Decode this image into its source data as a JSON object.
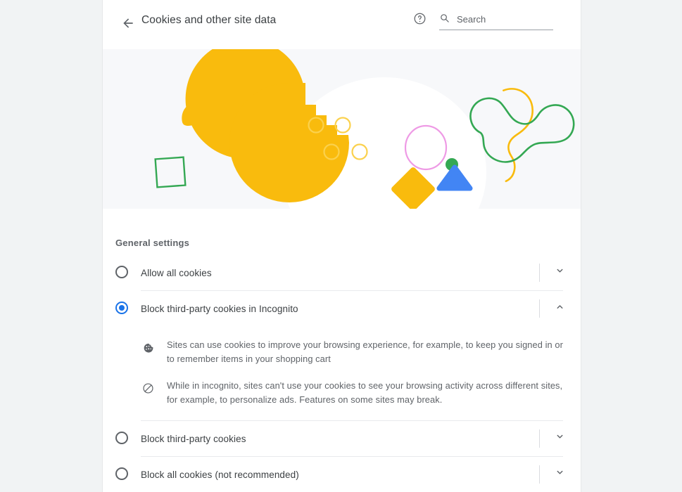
{
  "header": {
    "back_icon": "arrow-left-icon",
    "title": "Cookies and other site data",
    "help_icon": "help-circle-icon",
    "search_icon": "search-icon",
    "search_placeholder": "Search",
    "search_value": ""
  },
  "hero": {
    "illustration_name": "cookie-illustration",
    "colors": {
      "cookie_yellow": "#f9bb0d",
      "chip_outline": "#fbd14d",
      "blob_white": "#ffffff",
      "hero_background": "#f7f8fa",
      "blue_dot": "#a8c7fa",
      "gray_pill": "#e8eaed",
      "green_outline": "#34a853",
      "pink_circle": "#ee9ae5",
      "green_dot": "#34a853",
      "blue_triangle": "#4285f4"
    }
  },
  "settings": {
    "section_title": "General settings",
    "options": [
      {
        "id": "allow-all-cookies",
        "label": "Allow all cookies",
        "selected": false,
        "expanded": false,
        "chevron": "chevron-down-icon",
        "details": []
      },
      {
        "id": "block-third-party-incognito",
        "label": "Block third-party cookies in Incognito",
        "selected": true,
        "expanded": true,
        "chevron": "chevron-up-icon",
        "details": [
          {
            "icon": "cookie-icon",
            "text": "Sites can use cookies to improve your browsing experience, for example, to keep you signed in or to remember items in your shopping cart"
          },
          {
            "icon": "block-icon",
            "text": "While in incognito, sites can't use your cookies to see your browsing activity across different sites, for example, to personalize ads. Features on some sites may break."
          }
        ]
      },
      {
        "id": "block-third-party",
        "label": "Block third-party cookies",
        "selected": false,
        "expanded": false,
        "chevron": "chevron-down-icon",
        "details": []
      },
      {
        "id": "block-all-cookies",
        "label": "Block all cookies (not recommended)",
        "selected": false,
        "expanded": false,
        "chevron": "chevron-down-icon",
        "details": []
      }
    ],
    "accent_color": "#1a73e8",
    "text_color": "#3c4043",
    "muted_color": "#5f6368"
  }
}
